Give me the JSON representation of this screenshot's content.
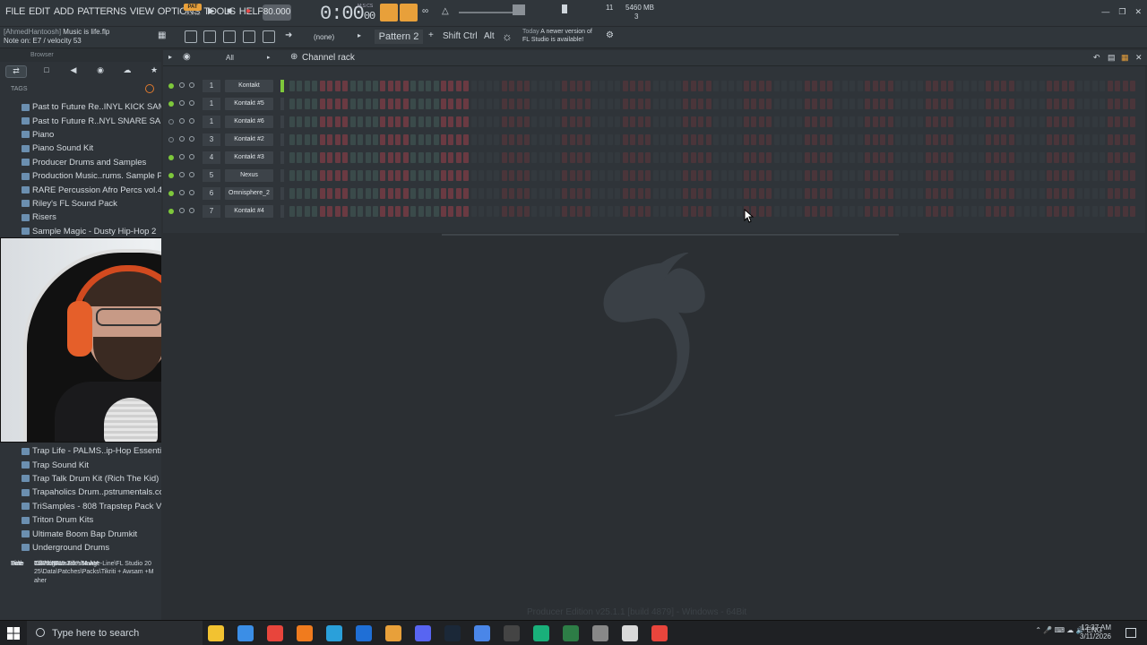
{
  "menu": [
    "FILE",
    "EDIT",
    "ADD",
    "PATTERNS",
    "VIEW",
    "OPTIONS",
    "TOOLS",
    "HELP"
  ],
  "transport": {
    "pat_label": "PAT",
    "song_label": "SONG",
    "tempo": "80.000",
    "time_main": "0:00",
    "time_sub": "00",
    "time_unit": "M:S:CS"
  },
  "memory": {
    "value": "5460 MB",
    "cpu": "11",
    "polyphony": "3"
  },
  "hint": {
    "user": "[AhmedHantoosh]",
    "project": "Music is life.flp",
    "note": "Note on: E7 / velocity 53"
  },
  "toolbar": {
    "none_label": "(none)",
    "pattern": "Pattern 2",
    "shift": "Shift",
    "ctrl": "Ctrl",
    "alt": "Alt"
  },
  "news": {
    "today": "Today",
    "line1": "A newer version of",
    "line2": "FL Studio is available!"
  },
  "browser": {
    "header": "Browser",
    "tags_label": "TAGS",
    "folders_top": [
      "Past to Future Re..INYL KICK SAMPLES",
      "Past to Future R..NYL SNARE SAMPLES",
      "Piano",
      "Piano Sound Kit",
      "Producer Drums and Samples",
      "Production Music..rums. Sample Pack",
      "RARE Percussion Afro Percs vol.4",
      "Riley's FL Sound Pack",
      "Risers",
      "Sample Magic - Dusty Hip-Hop 2"
    ],
    "folders_bottom": [
      "Trap Life - PALMS..ip-Hop Essentials 1",
      "Trap Sound Kit",
      "Trap Talk Drum Kit (Rich The Kid)",
      "Trapaholics Drum..pstrumentals.com)",
      "TriSamples - 808 Trapstep Pack Vol 1",
      "Triton Drum Kits",
      "Ultimate Boom Bap Drumkit",
      "Underground Drums"
    ],
    "info": {
      "title_label": "Title",
      "title": "Tikriti + Awsam +Maher",
      "date_label": "Date",
      "date": "11/20/2025 3:07:34 AM",
      "size_label": "Size",
      "size": "3.37 MB",
      "path_label": "Path",
      "path": "C:\\Program Files\\Image-Line\\FL Studio 2025\\Data\\Patches\\Packs\\Tikriti + Awsam +Maher"
    }
  },
  "rack": {
    "filter": "All",
    "title": "Channel rack",
    "channels": [
      {
        "num": "1",
        "name": "Kontakt",
        "active": true,
        "selected": true
      },
      {
        "num": "1",
        "name": "Kontakt #5",
        "active": true,
        "selected": false
      },
      {
        "num": "1",
        "name": "Kontakt #6",
        "active": false,
        "selected": false
      },
      {
        "num": "3",
        "name": "Kontakt #2",
        "active": false,
        "selected": false
      },
      {
        "num": "4",
        "name": "Kontakt #3",
        "active": true,
        "selected": false
      },
      {
        "num": "5",
        "name": "Nexus",
        "active": true,
        "selected": false
      },
      {
        "num": "6",
        "name": "Omnisphere_2",
        "active": true,
        "selected": false
      },
      {
        "num": "7",
        "name": "Kontakt #4",
        "active": true,
        "selected": false
      }
    ],
    "colors": {
      "step_dark": "#3a4a4a",
      "step_red": "#6a3a42",
      "step_dim_dark": "#33393e",
      "step_dim_red": "#4a353a"
    }
  },
  "footer": {
    "version": "Producer Edition v25.1.1 [build 4879] - Windows - 64Bit"
  },
  "taskbar": {
    "search_placeholder": "Type here to search",
    "lang": "ENG",
    "time": "12:37 AM",
    "date": "3/11/2026",
    "app_colors": [
      "#f2c231",
      "#3b8ee6",
      "#e8453c",
      "#f07b1e",
      "#2aa0da",
      "#1f6fd6",
      "#e8a03a",
      "#5865f2",
      "#1b2838",
      "#4a86e8",
      "#444",
      "#19b07a",
      "#2d7d46",
      "#888",
      "#d9d9d9",
      "#e8453c"
    ]
  }
}
